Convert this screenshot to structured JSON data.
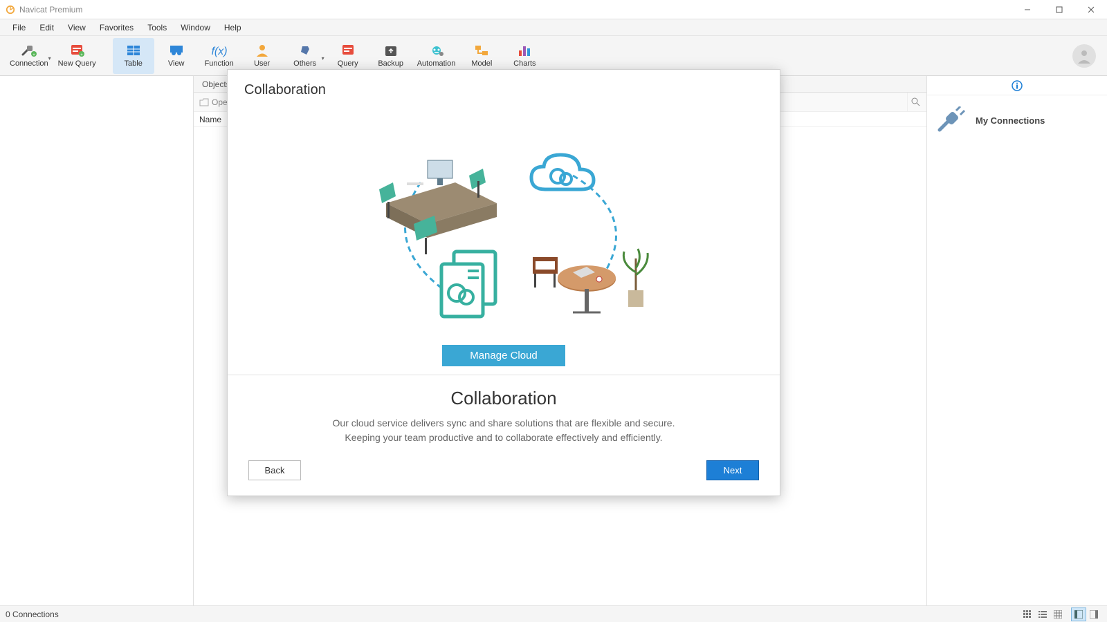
{
  "title": "Navicat Premium",
  "menu": [
    "File",
    "Edit",
    "View",
    "Favorites",
    "Tools",
    "Window",
    "Help"
  ],
  "toolbar": [
    {
      "id": "connection",
      "label": "Connection",
      "caret": true
    },
    {
      "id": "newquery",
      "label": "New Query"
    },
    {
      "id": "table",
      "label": "Table",
      "active": true
    },
    {
      "id": "view",
      "label": "View"
    },
    {
      "id": "function",
      "label": "Function"
    },
    {
      "id": "user",
      "label": "User"
    },
    {
      "id": "others",
      "label": "Others",
      "caret": true
    },
    {
      "id": "query",
      "label": "Query"
    },
    {
      "id": "backup",
      "label": "Backup"
    },
    {
      "id": "automation",
      "label": "Automation"
    },
    {
      "id": "model",
      "label": "Model"
    },
    {
      "id": "charts",
      "label": "Charts"
    }
  ],
  "tabs": {
    "objects": "Objects"
  },
  "open_label": "Open",
  "name_header": "Name",
  "right_pane": {
    "title": "My Connections"
  },
  "status": {
    "connections": "0 Connections"
  },
  "dialog": {
    "title": "Collaboration",
    "manage_button": "Manage Cloud",
    "heading": "Collaboration",
    "desc1": "Our cloud service delivers sync and share solutions that are flexible and secure.",
    "desc2": "Keeping your team productive and to collaborate effectively and efficiently.",
    "back": "Back",
    "next": "Next"
  }
}
